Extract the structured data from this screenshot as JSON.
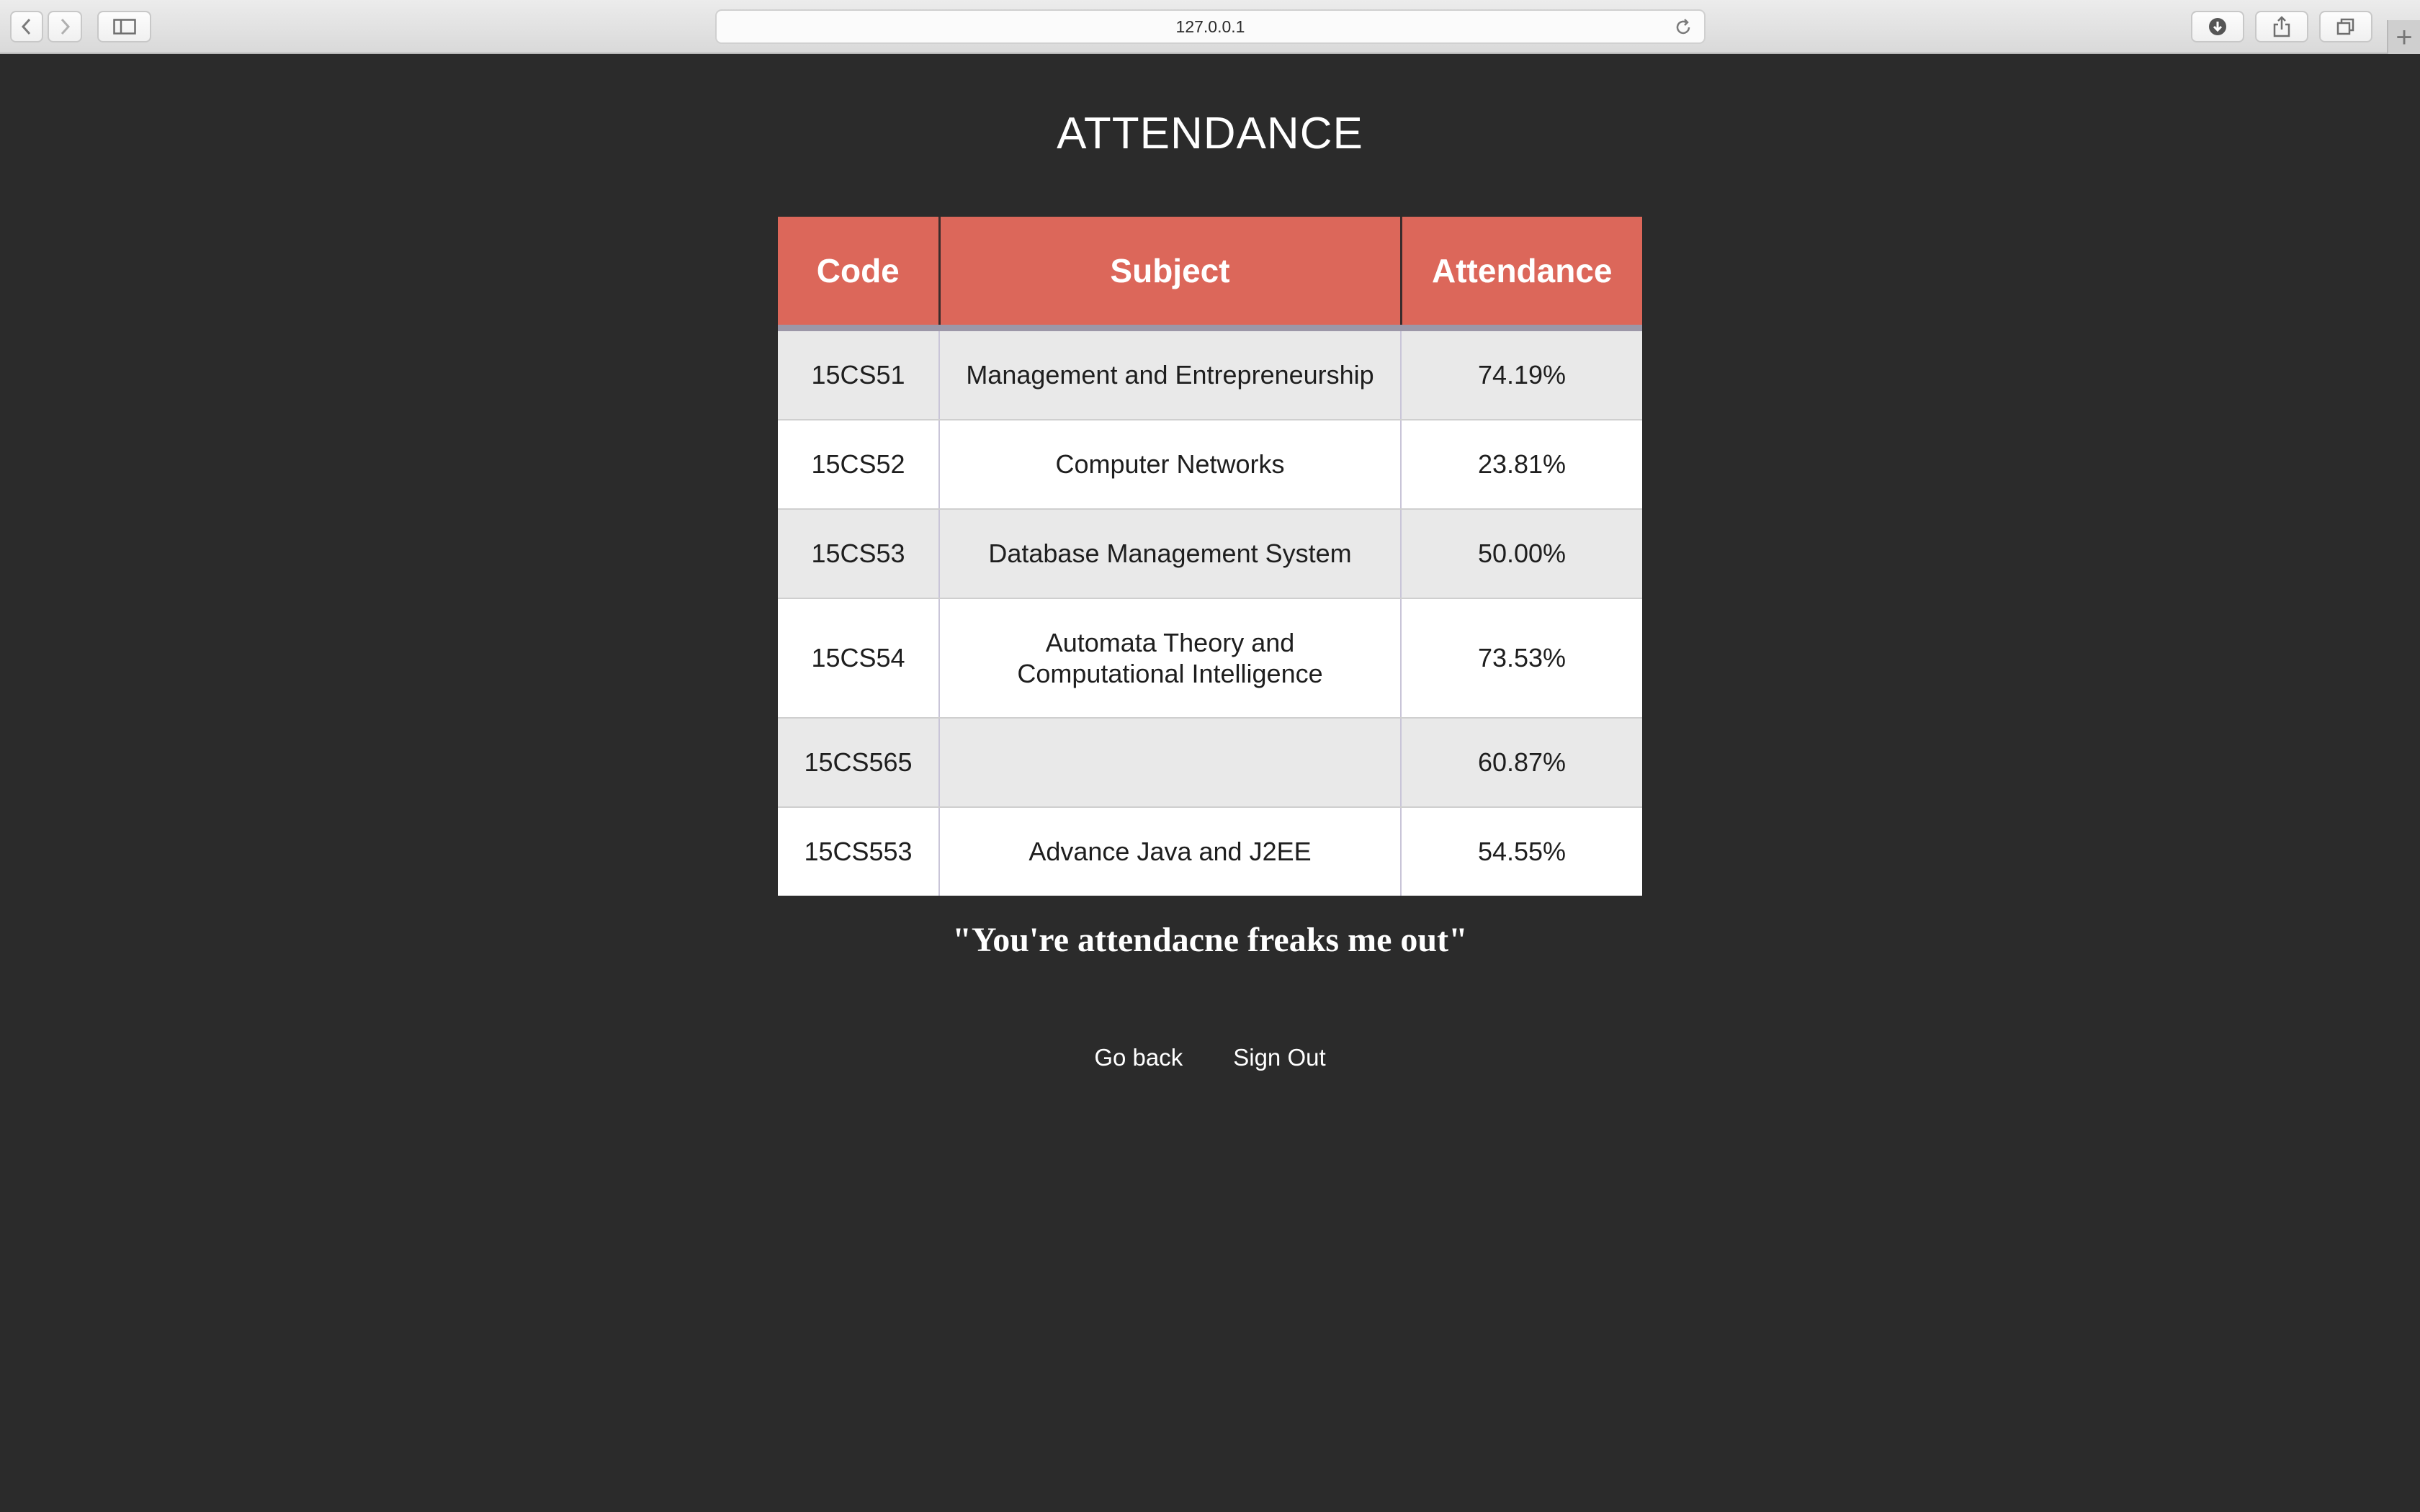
{
  "browser": {
    "url": "127.0.0.1",
    "new_tab_symbol": "+"
  },
  "page": {
    "title": "ATTENDANCE",
    "quote": "\"You're attendacne freaks me out\""
  },
  "table": {
    "headers": [
      "Code",
      "Subject",
      "Attendance"
    ],
    "rows": [
      {
        "code": "15CS51",
        "subject": "Management and Entrepreneurship",
        "attendance": "74.19%"
      },
      {
        "code": "15CS52",
        "subject": "Computer Networks",
        "attendance": "23.81%"
      },
      {
        "code": "15CS53",
        "subject": "Database Management System",
        "attendance": "50.00%"
      },
      {
        "code": "15CS54",
        "subject": "Automata Theory and Computational Intelligence",
        "attendance": "73.53%"
      },
      {
        "code": "15CS565",
        "subject": "",
        "attendance": "60.87%"
      },
      {
        "code": "15CS553",
        "subject": "Advance Java and J2EE",
        "attendance": "54.55%"
      }
    ]
  },
  "links": {
    "go_back": "Go back",
    "sign_out": "Sign Out"
  },
  "colors": {
    "page_background": "#2b2b2b",
    "header_accent": "#dc675a",
    "row_odd": "#e9e9e9",
    "row_even": "#ffffff"
  }
}
